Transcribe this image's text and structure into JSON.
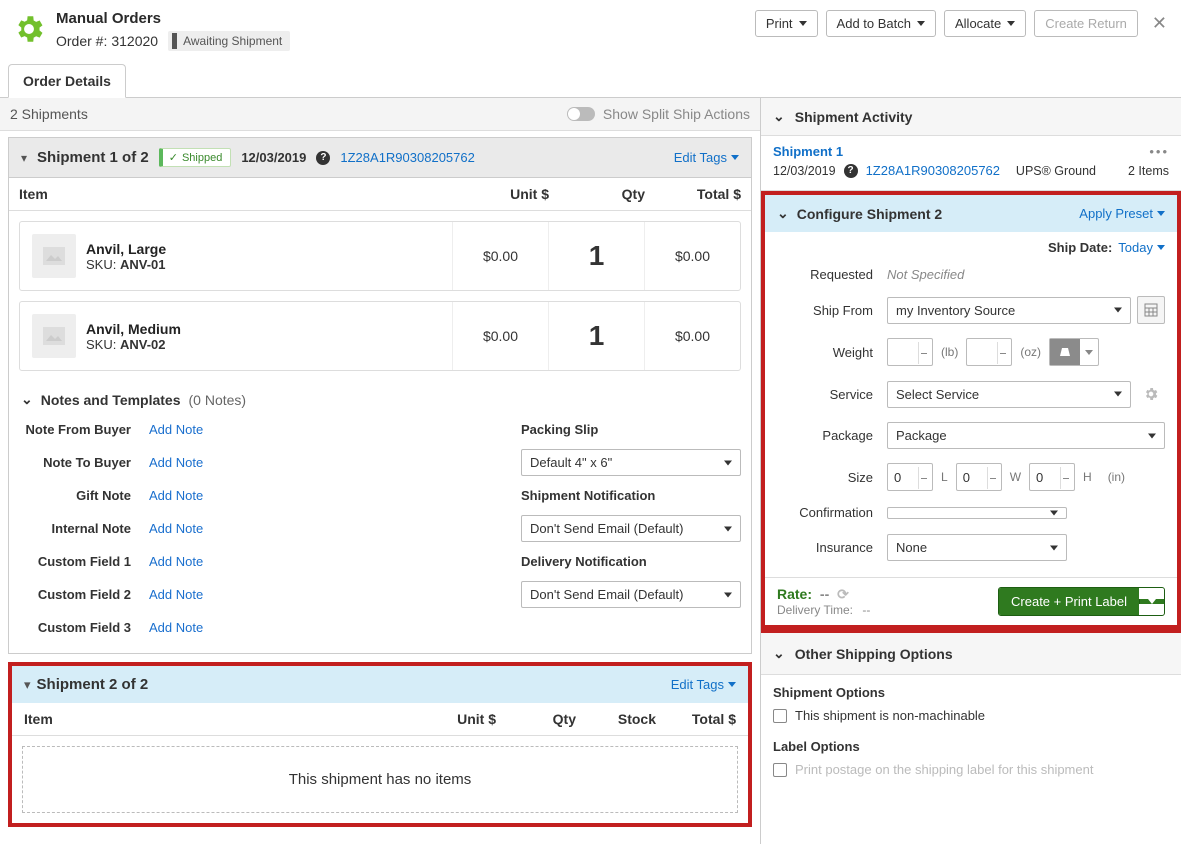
{
  "header": {
    "source_name": "Manual Orders",
    "order_label": "Order #:",
    "order_number": "312020",
    "status": "Awaiting Shipment",
    "print": "Print",
    "add_to_batch": "Add to Batch",
    "allocate": "Allocate",
    "create_return": "Create Return"
  },
  "tabs": {
    "order_details": "Order Details"
  },
  "ship_count": {
    "label": "2 Shipments",
    "split_ship": "Show Split Ship Actions"
  },
  "shipment1": {
    "title": "Shipment 1 of 2",
    "status": "Shipped",
    "date": "12/03/2019",
    "tracking": "1Z28A1R90308205762",
    "edit_tags": "Edit Tags",
    "cols": {
      "item": "Item",
      "unit": "Unit $",
      "qty": "Qty",
      "total": "Total $"
    },
    "items": [
      {
        "name": "Anvil, Large",
        "sku_label": "SKU:",
        "sku": "ANV-01",
        "unit": "$0.00",
        "qty": "1",
        "total": "$0.00"
      },
      {
        "name": "Anvil, Medium",
        "sku_label": "SKU:",
        "sku": "ANV-02",
        "unit": "$0.00",
        "qty": "1",
        "total": "$0.00"
      }
    ],
    "notes": {
      "header": "Notes and Templates",
      "count": "(0 Notes)",
      "add_note": "Add Note",
      "labels": {
        "from_buyer": "Note From Buyer",
        "to_buyer": "Note To Buyer",
        "gift": "Gift Note",
        "internal": "Internal Note",
        "c1": "Custom Field 1",
        "c2": "Custom Field 2",
        "c3": "Custom Field 3"
      },
      "right": {
        "packing_slip_label": "Packing Slip",
        "packing_slip_value": "Default 4\" x 6\"",
        "ship_notif_label": "Shipment Notification",
        "ship_notif_value": "Don't Send Email (Default)",
        "deliv_notif_label": "Delivery Notification",
        "deliv_notif_value": "Don't Send Email (Default)"
      }
    }
  },
  "shipment2": {
    "title": "Shipment 2 of 2",
    "edit_tags": "Edit Tags",
    "cols": {
      "item": "Item",
      "unit": "Unit $",
      "qty": "Qty",
      "stock": "Stock",
      "total": "Total $"
    },
    "no_items": "This shipment has no items"
  },
  "activity": {
    "section": "Shipment Activity",
    "link": "Shipment 1",
    "date": "12/03/2019",
    "tracking": "1Z28A1R90308205762",
    "service": "UPS® Ground",
    "items": "2 Items"
  },
  "configure": {
    "title": "Configure Shipment 2",
    "apply_preset": "Apply Preset",
    "shipdate_label": "Ship Date:",
    "shipdate_value": "Today",
    "requested_label": "Requested",
    "requested_value": "Not Specified",
    "shipfrom_label": "Ship From",
    "shipfrom_value": "my Inventory Source",
    "weight_label": "Weight",
    "lb_unit": "(lb)",
    "oz_unit": "(oz)",
    "service_label": "Service",
    "service_value": "Select Service",
    "package_label": "Package",
    "package_value": "Package",
    "size_label": "Size",
    "size_l": "0",
    "size_w": "0",
    "size_h": "0",
    "unit_l": "L",
    "unit_w": "W",
    "unit_h": "H",
    "size_unit": "(in)",
    "confirm_label": "Confirmation",
    "insurance_label": "Insurance",
    "insurance_value": "None",
    "rate_label": "Rate:",
    "rate_value": "--",
    "delivery_label": "Delivery Time:",
    "delivery_value": "--",
    "create_label": "Create + Print Label"
  },
  "oso": {
    "title": "Other Shipping Options",
    "shipment_options": "Shipment Options",
    "non_machinable": "This shipment is non-machinable",
    "label_options": "Label Options",
    "print_postage": "Print postage on the shipping label for this shipment"
  }
}
